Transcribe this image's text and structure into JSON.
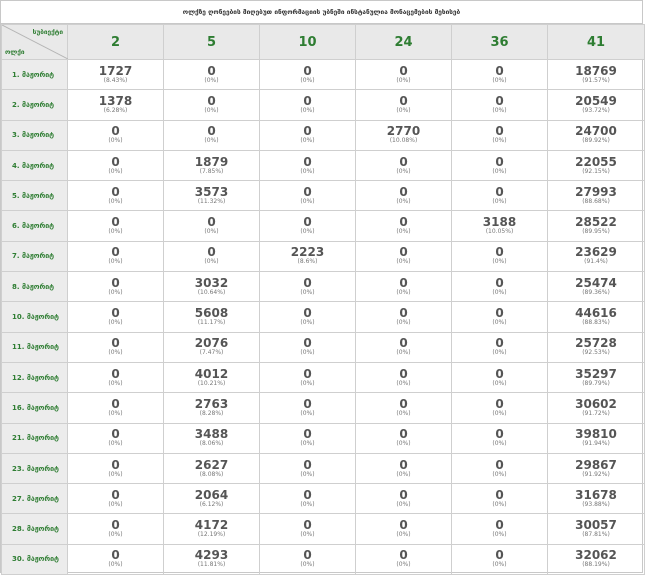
{
  "title": "ოლქზე ღონეების მიღებუთ ინფორმაციის უბნეში ინსტანულია მონაცემების მეხისებ",
  "corner": {
    "col_label": "სუბიექტი",
    "row_label": "ოლქი"
  },
  "columns": [
    "2",
    "5",
    "10",
    "24",
    "36",
    "41"
  ],
  "rows": [
    {
      "label": "1. მაჟორიტ",
      "cells": [
        [
          "1727",
          "(8.43%)"
        ],
        [
          "0",
          "(0%)"
        ],
        [
          "0",
          "(0%)"
        ],
        [
          "0",
          "(0%)"
        ],
        [
          "0",
          "(0%)"
        ],
        [
          "18769",
          "(91.57%)"
        ]
      ]
    },
    {
      "label": "2. მაჟორიტ",
      "cells": [
        [
          "1378",
          "(6.28%)"
        ],
        [
          "0",
          "(0%)"
        ],
        [
          "0",
          "(0%)"
        ],
        [
          "0",
          "(0%)"
        ],
        [
          "0",
          "(0%)"
        ],
        [
          "20549",
          "(93.72%)"
        ]
      ]
    },
    {
      "label": "3. მაჟორიტ",
      "cells": [
        [
          "0",
          "(0%)"
        ],
        [
          "0",
          "(0%)"
        ],
        [
          "0",
          "(0%)"
        ],
        [
          "2770",
          "(10.08%)"
        ],
        [
          "0",
          "(0%)"
        ],
        [
          "24700",
          "(89.92%)"
        ]
      ]
    },
    {
      "label": "4. მაჟორიტ",
      "cells": [
        [
          "0",
          "(0%)"
        ],
        [
          "1879",
          "(7.85%)"
        ],
        [
          "0",
          "(0%)"
        ],
        [
          "0",
          "(0%)"
        ],
        [
          "0",
          "(0%)"
        ],
        [
          "22055",
          "(92.15%)"
        ]
      ]
    },
    {
      "label": "5. მაჟორიტ",
      "cells": [
        [
          "0",
          "(0%)"
        ],
        [
          "3573",
          "(11.32%)"
        ],
        [
          "0",
          "(0%)"
        ],
        [
          "0",
          "(0%)"
        ],
        [
          "0",
          "(0%)"
        ],
        [
          "27993",
          "(88.68%)"
        ]
      ]
    },
    {
      "label": "6. მაჟორიტ",
      "cells": [
        [
          "0",
          "(0%)"
        ],
        [
          "0",
          "(0%)"
        ],
        [
          "0",
          "(0%)"
        ],
        [
          "0",
          "(0%)"
        ],
        [
          "3188",
          "(10.05%)"
        ],
        [
          "28522",
          "(89.95%)"
        ]
      ]
    },
    {
      "label": "7. მაჟორიტ",
      "cells": [
        [
          "0",
          "(0%)"
        ],
        [
          "0",
          "(0%)"
        ],
        [
          "2223",
          "(8.6%)"
        ],
        [
          "0",
          "(0%)"
        ],
        [
          "0",
          "(0%)"
        ],
        [
          "23629",
          "(91.4%)"
        ]
      ]
    },
    {
      "label": "8. მაჟორიტ",
      "cells": [
        [
          "0",
          "(0%)"
        ],
        [
          "3032",
          "(10.64%)"
        ],
        [
          "0",
          "(0%)"
        ],
        [
          "0",
          "(0%)"
        ],
        [
          "0",
          "(0%)"
        ],
        [
          "25474",
          "(89.36%)"
        ]
      ]
    },
    {
      "label": "10. მაჟორიტ",
      "cells": [
        [
          "0",
          "(0%)"
        ],
        [
          "5608",
          "(11.17%)"
        ],
        [
          "0",
          "(0%)"
        ],
        [
          "0",
          "(0%)"
        ],
        [
          "0",
          "(0%)"
        ],
        [
          "44616",
          "(88.83%)"
        ]
      ]
    },
    {
      "label": "11. მაჟორიტ",
      "cells": [
        [
          "0",
          "(0%)"
        ],
        [
          "2076",
          "(7.47%)"
        ],
        [
          "0",
          "(0%)"
        ],
        [
          "0",
          "(0%)"
        ],
        [
          "0",
          "(0%)"
        ],
        [
          "25728",
          "(92.53%)"
        ]
      ]
    },
    {
      "label": "12. მაჟორიტ",
      "cells": [
        [
          "0",
          "(0%)"
        ],
        [
          "4012",
          "(10.21%)"
        ],
        [
          "0",
          "(0%)"
        ],
        [
          "0",
          "(0%)"
        ],
        [
          "0",
          "(0%)"
        ],
        [
          "35297",
          "(89.79%)"
        ]
      ]
    },
    {
      "label": "16. მაჟორიტ",
      "cells": [
        [
          "0",
          "(0%)"
        ],
        [
          "2763",
          "(8.28%)"
        ],
        [
          "0",
          "(0%)"
        ],
        [
          "0",
          "(0%)"
        ],
        [
          "0",
          "(0%)"
        ],
        [
          "30602",
          "(91.72%)"
        ]
      ]
    },
    {
      "label": "21. მაჟორიტ",
      "cells": [
        [
          "0",
          "(0%)"
        ],
        [
          "3488",
          "(8.06%)"
        ],
        [
          "0",
          "(0%)"
        ],
        [
          "0",
          "(0%)"
        ],
        [
          "0",
          "(0%)"
        ],
        [
          "39810",
          "(91.94%)"
        ]
      ]
    },
    {
      "label": "23. მაჟორიტ",
      "cells": [
        [
          "0",
          "(0%)"
        ],
        [
          "2627",
          "(8.08%)"
        ],
        [
          "0",
          "(0%)"
        ],
        [
          "0",
          "(0%)"
        ],
        [
          "0",
          "(0%)"
        ],
        [
          "29867",
          "(91.92%)"
        ]
      ]
    },
    {
      "label": "27. მაჟორიტ",
      "cells": [
        [
          "0",
          "(0%)"
        ],
        [
          "2064",
          "(6.12%)"
        ],
        [
          "0",
          "(0%)"
        ],
        [
          "0",
          "(0%)"
        ],
        [
          "0",
          "(0%)"
        ],
        [
          "31678",
          "(93.88%)"
        ]
      ]
    },
    {
      "label": "28. მაჟორიტ",
      "cells": [
        [
          "0",
          "(0%)"
        ],
        [
          "4172",
          "(12.19%)"
        ],
        [
          "0",
          "(0%)"
        ],
        [
          "0",
          "(0%)"
        ],
        [
          "0",
          "(0%)"
        ],
        [
          "30057",
          "(87.81%)"
        ]
      ]
    },
    {
      "label": "30. მაჟორიტ",
      "cells": [
        [
          "0",
          "(0%)"
        ],
        [
          "4293",
          "(11.81%)"
        ],
        [
          "0",
          "(0%)"
        ],
        [
          "0",
          "(0%)"
        ],
        [
          "0",
          "(0%)"
        ],
        [
          "32062",
          "(88.19%)"
        ]
      ]
    }
  ]
}
